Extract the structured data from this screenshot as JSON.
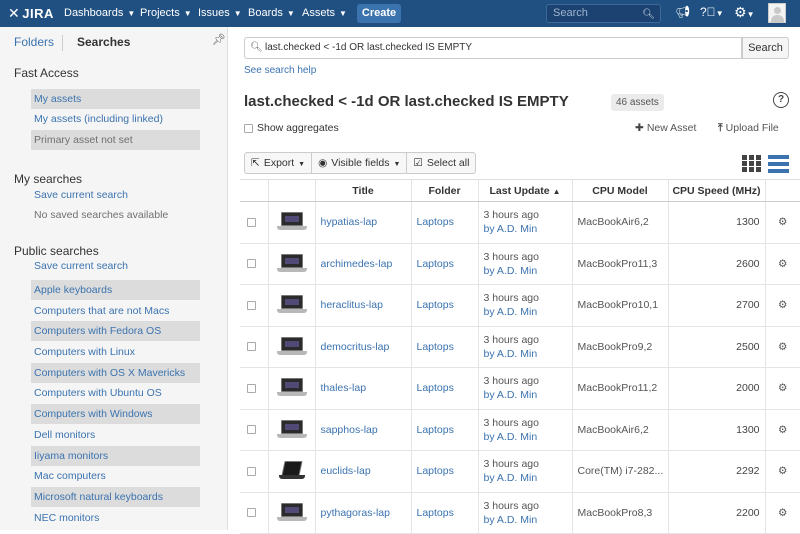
{
  "topbar": {
    "logo": "JIRA",
    "nav": [
      {
        "label": "Dashboards"
      },
      {
        "label": "Projects"
      },
      {
        "label": "Issues"
      },
      {
        "label": "Boards"
      },
      {
        "label": "Assets"
      }
    ],
    "create_label": "Create",
    "search_placeholder": "Search"
  },
  "sidebar": {
    "tabs": {
      "folders": "Folders",
      "searches": "Searches"
    },
    "fast_access": {
      "heading": "Fast Access",
      "items": [
        "My assets",
        "My assets (including linked)",
        "Primary asset not set"
      ]
    },
    "my_searches": {
      "heading": "My searches",
      "save_label": "Save current search",
      "empty_label": "No saved searches available"
    },
    "public_searches": {
      "heading": "Public searches",
      "save_label": "Save current search",
      "items": [
        "Apple keyboards",
        "Computers that are not Macs",
        "Computers with Fedora OS",
        "Computers with Linux",
        "Computers with OS X Mavericks",
        "Computers with Ubuntu OS",
        "Computers with Windows",
        "Dell monitors",
        "Iiyama monitors",
        "Mac computers",
        "Microsoft natural keyboards",
        "NEC monitors"
      ]
    }
  },
  "main": {
    "query": "last.checked < -1d OR last.checked IS EMPTY",
    "search_button": "Search",
    "help_link": "See search help",
    "title": "last.checked < -1d OR last.checked IS EMPTY",
    "count": "46 assets",
    "show_aggregates": "Show aggregates",
    "new_asset": "New Asset",
    "upload_file": "Upload File",
    "toolbar": {
      "export": "Export",
      "visible_fields": "Visible fields",
      "select_all": "Select all"
    },
    "columns": {
      "title": "Title",
      "folder": "Folder",
      "last_update": "Last Update",
      "cpu_model": "CPU Model",
      "cpu_speed": "CPU Speed (MHz)"
    },
    "rows": [
      {
        "title": "hypatias-lap",
        "folder": "Laptops",
        "updated": "3 hours ago",
        "by": "by A.D. Min",
        "cpu": "MacBookAir6,2",
        "speed": "1300"
      },
      {
        "title": "archimedes-lap",
        "folder": "Laptops",
        "updated": "3 hours ago",
        "by": "by A.D. Min",
        "cpu": "MacBookPro11,3",
        "speed": "2600"
      },
      {
        "title": "heraclitus-lap",
        "folder": "Laptops",
        "updated": "3 hours ago",
        "by": "by A.D. Min",
        "cpu": "MacBookPro10,1",
        "speed": "2700"
      },
      {
        "title": "democritus-lap",
        "folder": "Laptops",
        "updated": "3 hours ago",
        "by": "by A.D. Min",
        "cpu": "MacBookPro9,2",
        "speed": "2500"
      },
      {
        "title": "thales-lap",
        "folder": "Laptops",
        "updated": "3 hours ago",
        "by": "by A.D. Min",
        "cpu": "MacBookPro11,2",
        "speed": "2000"
      },
      {
        "title": "sapphos-lap",
        "folder": "Laptops",
        "updated": "3 hours ago",
        "by": "by A.D. Min",
        "cpu": "MacBookAir6,2",
        "speed": "1300"
      },
      {
        "title": "euclids-lap",
        "folder": "Laptops",
        "updated": "3 hours ago",
        "by": "by A.D. Min",
        "cpu": "Core(TM) i7-282...",
        "speed": "2292"
      },
      {
        "title": "pythagoras-lap",
        "folder": "Laptops",
        "updated": "3 hours ago",
        "by": "by A.D. Min",
        "cpu": "MacBookPro8,3",
        "speed": "2200"
      }
    ]
  },
  "colors": {
    "topbar": "#205081",
    "link": "#3b73af",
    "create": "#3b73af"
  },
  "icons": [
    "jira-logo-icon",
    "search-icon",
    "megaphone-icon",
    "help-icon",
    "gear-icon",
    "avatar",
    "pin-icon",
    "plus-icon",
    "upload-icon",
    "export-icon",
    "eye-icon",
    "checkbox-icon",
    "grid-view-icon",
    "list-view-icon",
    "laptop-thumbnail",
    "row-gear-icon"
  ]
}
